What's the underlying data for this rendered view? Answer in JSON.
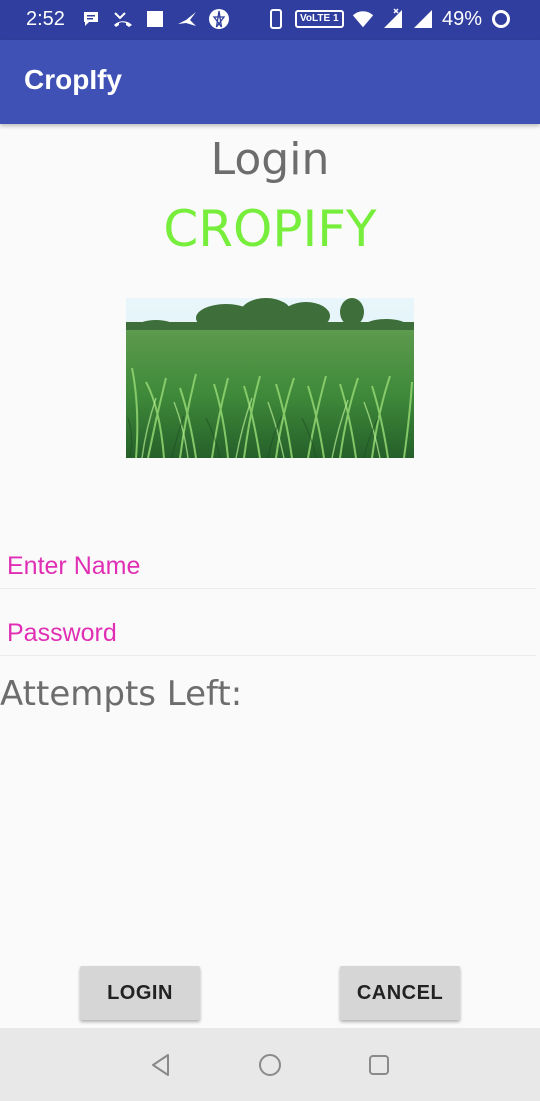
{
  "status_bar": {
    "time": "2:52",
    "volte_label": "VoLTE 1",
    "battery": "49%",
    "left_icons": [
      "chat-icon",
      "missed-call-icon",
      "square-notification-icon",
      "bird-icon",
      "pentagram-icon"
    ],
    "right_icons": [
      "phone-outline-icon",
      "volte-icon",
      "wifi-icon",
      "signal-x-icon",
      "signal-icon",
      "battery-ring-icon"
    ]
  },
  "app_bar": {
    "title": "CropIfy"
  },
  "main": {
    "heading": "Login",
    "brand": "CROPIFY",
    "name_placeholder": "Enter Name",
    "password_placeholder": "Password",
    "attempts_label": "Attempts Left:"
  },
  "buttons": {
    "login": "LOGIN",
    "cancel": "CANCEL"
  },
  "nav_bar": {
    "icons": [
      "back-icon",
      "home-icon",
      "recents-icon"
    ]
  },
  "colors": {
    "status_bar": "#303f9f",
    "app_bar": "#3f51b5",
    "brand_text": "#76ee3b",
    "hint_text": "#e02fb4",
    "heading_text": "#6d6d6d"
  }
}
